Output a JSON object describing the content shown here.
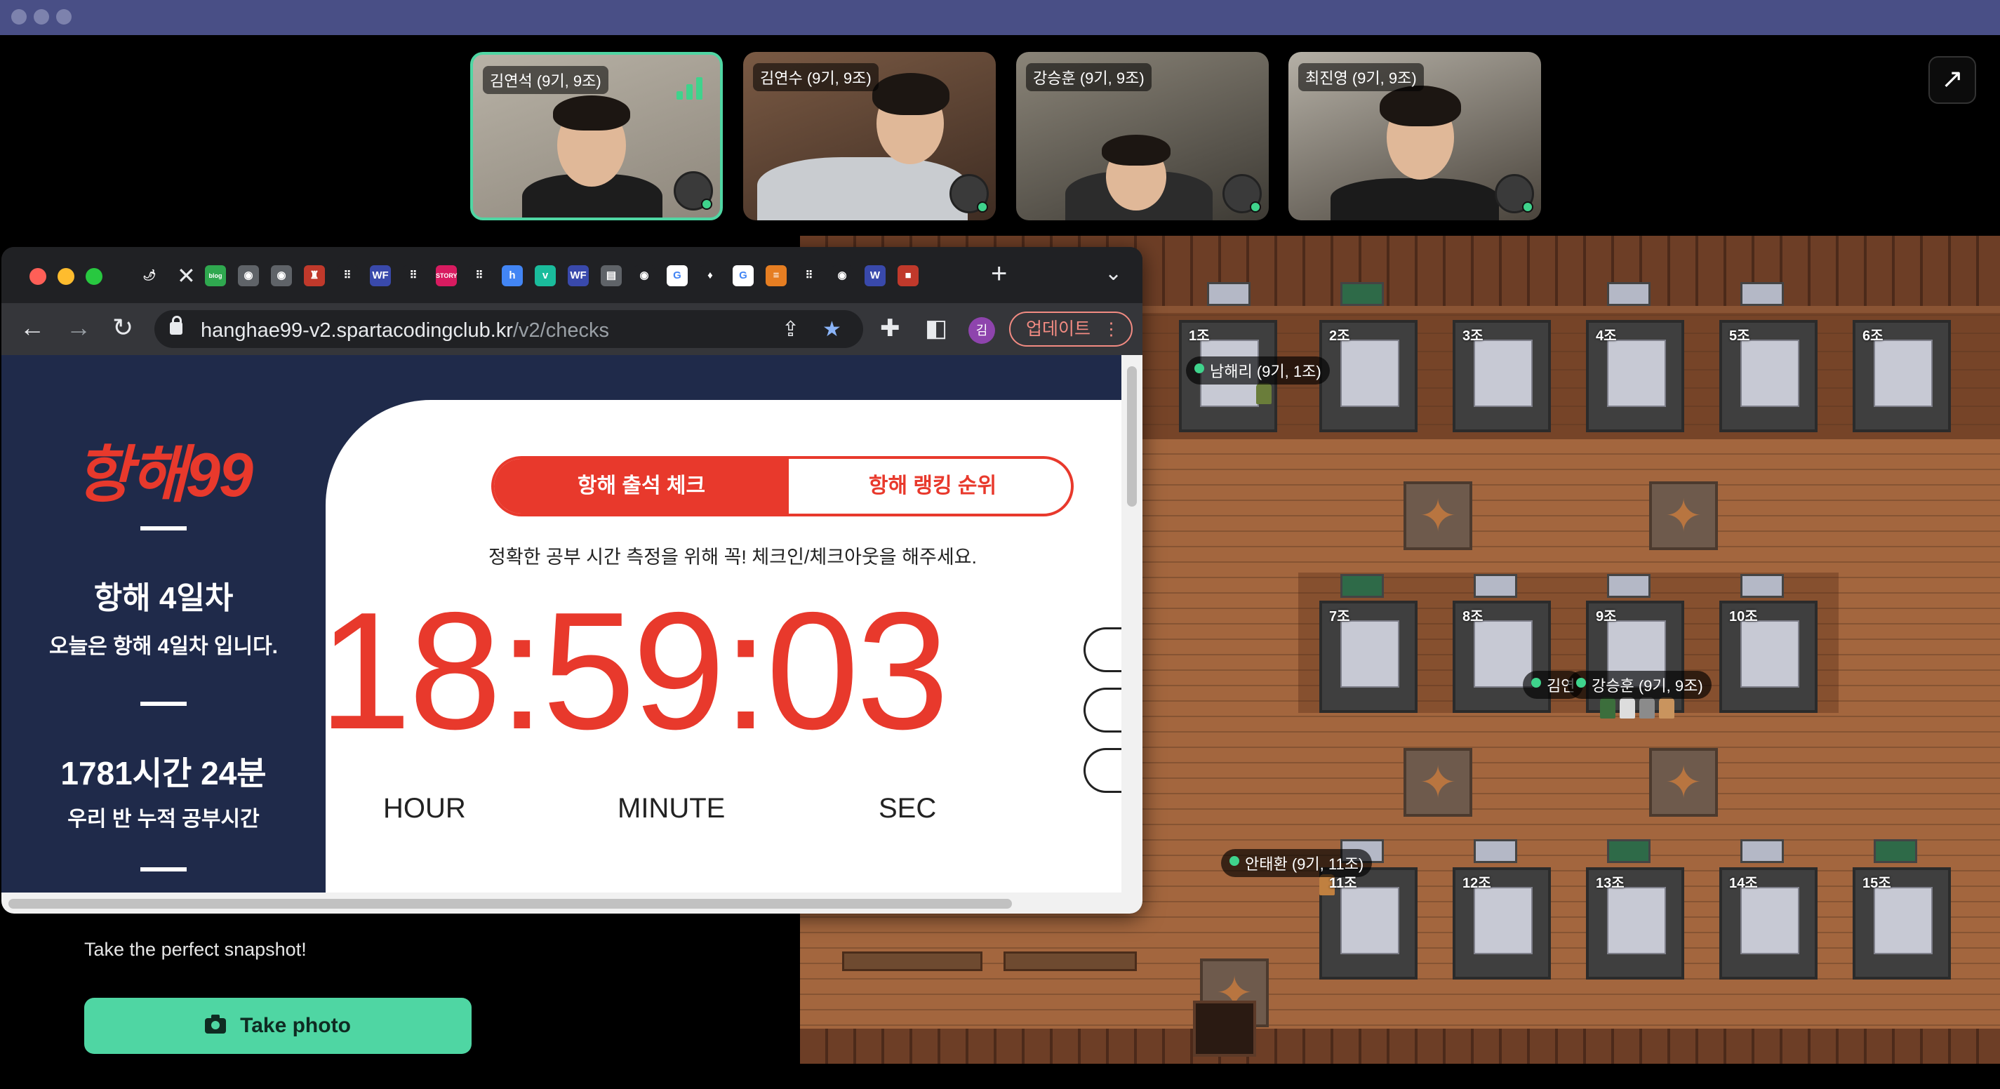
{
  "video_tiles": [
    {
      "name": "김연석 (9기, 9조)",
      "active": true
    },
    {
      "name": "김연수 (9기, 9조)",
      "active": false
    },
    {
      "name": "강승훈 (9기, 9조)",
      "active": false
    },
    {
      "name": "최진영 (9기, 9조)",
      "active": false
    }
  ],
  "expand_icon": "↗",
  "map": {
    "desks_top": [
      "1조",
      "2조",
      "3조",
      "4조",
      "5조",
      "6조"
    ],
    "desks_mid": [
      "7조",
      "8조",
      "9조",
      "10조"
    ],
    "desks_bot": [
      "11조",
      "12조",
      "13조",
      "14조",
      "15조"
    ],
    "player_tags": {
      "p1": "남해리 (9기, 1조)",
      "p2_partial": "김연",
      "p3": "강승훈 (9기, 9조)",
      "p3_suffix": "조)",
      "p4": "안태환 (9기, 11조)"
    }
  },
  "left_panel": {
    "snapshot_text": "Take the perfect snapshot!",
    "take_photo_label": "Take photo"
  },
  "browser": {
    "tab_icons": [
      "🌶",
      "blog",
      "◉",
      "◉",
      "♜",
      "⠿",
      "WF",
      "⠿",
      "STORY",
      "⠿",
      "h",
      "v",
      "WF",
      "▤",
      "◉",
      "G",
      "♦",
      "G",
      "≡",
      "⠿",
      "◉",
      "W",
      "■"
    ],
    "new_tab": "+",
    "tab_menu": "⌄",
    "url_host": "hanghae99-v2.spartacodingclub.kr",
    "url_path": "/v2/checks",
    "profile_initial": "김",
    "update_label": "업데이트",
    "update_kebab": "⋮"
  },
  "page": {
    "logo": "항해99",
    "day_title": "항해 4일차",
    "day_subtitle": "오늘은 항해 4일차 입니다.",
    "total_time": "1781시간 24분",
    "total_label": "우리 반 누적 공부시간",
    "tab_attendance": "항해 출석 체크",
    "tab_ranking": "항해 랭킹 순위",
    "notice": "정확한 공부 시간 측정을 위해 꼭! 체크인/체크아웃을 해주세요.",
    "clock": "18:59:03",
    "unit_hour": "HOUR",
    "unit_minute": "MINUTE",
    "unit_sec": "SEC"
  },
  "colors": {
    "accent_red": "#e8392c",
    "navy": "#1f2a4a",
    "mint": "#4fd6a3",
    "title_bar": "#494f86"
  }
}
